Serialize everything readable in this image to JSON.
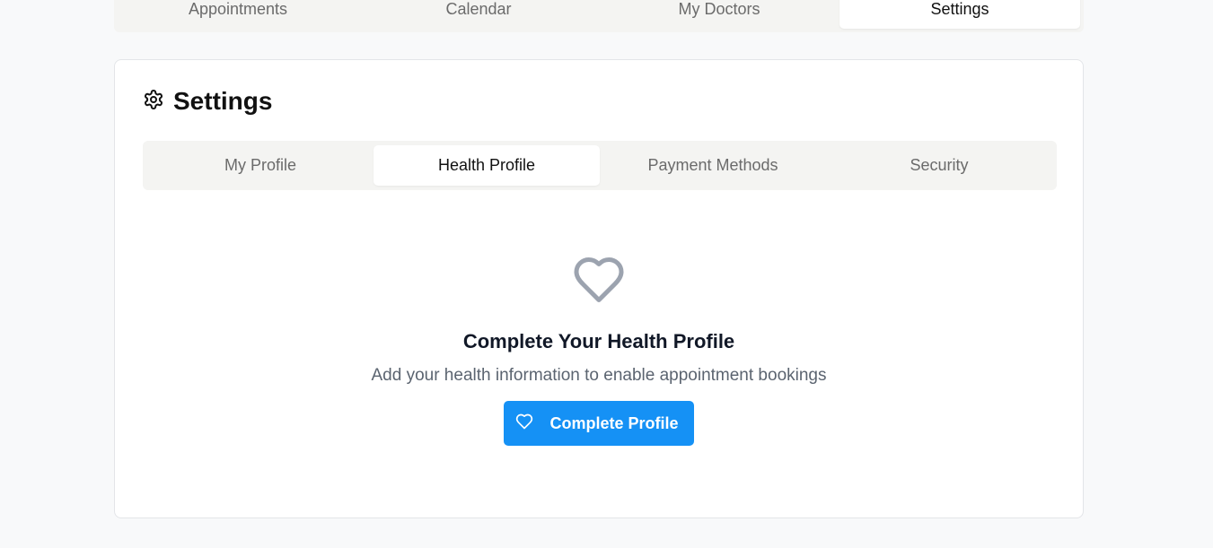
{
  "top_nav": {
    "tabs": [
      {
        "label": "Appointments",
        "active": false
      },
      {
        "label": "Calendar",
        "active": false
      },
      {
        "label": "My Doctors",
        "active": false
      },
      {
        "label": "Settings",
        "active": true
      }
    ]
  },
  "settings": {
    "icon": "gear-icon",
    "title": "Settings",
    "tabs": [
      {
        "label": "My Profile",
        "active": false
      },
      {
        "label": "Health Profile",
        "active": true
      },
      {
        "label": "Payment Methods",
        "active": false
      },
      {
        "label": "Security",
        "active": false
      }
    ]
  },
  "empty_state": {
    "icon": "heart-icon",
    "title": "Complete Your Health Profile",
    "description": "Add your health information to enable appointment bookings",
    "button_icon": "heart-icon",
    "button_label": "Complete Profile"
  },
  "colors": {
    "accent": "#1591f5",
    "heart_icon": "#9ca3af",
    "page_background": "#f8f9fa",
    "tab_strip": "#f4f4f2"
  }
}
